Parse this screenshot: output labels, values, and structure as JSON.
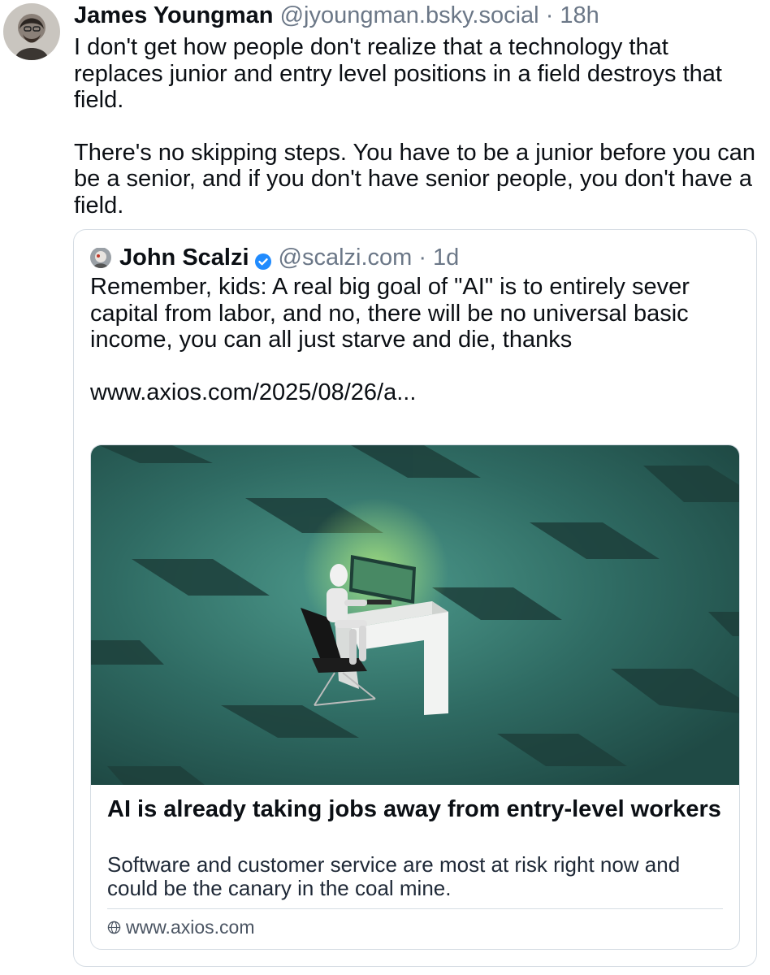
{
  "post": {
    "author": {
      "name": "James Youngman",
      "handle": "@jyoungman.bsky.social",
      "separator": "·",
      "time": "18h"
    },
    "paragraphs": [
      "I don't get how people don't realize that a technology that replaces junior and entry level positions in a field destroys that field.",
      "There's no skipping steps. You have to be a junior before you can be a senior, and if you don't have senior people, you don't have a field."
    ]
  },
  "quote": {
    "author": {
      "name": "John Scalzi",
      "verified_icon": "verified-check-icon",
      "handle": "@scalzi.com",
      "separator": "·",
      "time": "1d"
    },
    "paragraphs": [
      "Remember, kids: A real big goal of \"AI\" is to entirely sever capital from labor, and no, there will be no universal basic income, you can all just starve and die, thanks",
      "www.axios.com/2025/08/26/a..."
    ],
    "link_card": {
      "title": "AI is already taking jobs away from entry-level workers",
      "description": "Software and customer service are most at risk right now and could be the canary in the coal mine.",
      "domain": "www.axios.com",
      "domain_icon": "globe-icon"
    }
  },
  "colors": {
    "text_primary": "#0b0f14",
    "text_secondary": "#6b7787",
    "border": "#d6dde4",
    "verified_blue": "#208bfe",
    "image_teal": "#2f6b63"
  }
}
